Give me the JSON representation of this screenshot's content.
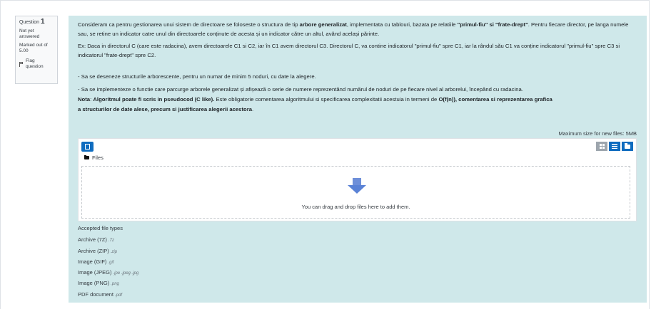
{
  "question_info": {
    "question_label": "Question",
    "question_number": "1",
    "state": "Not yet answered",
    "grade": "Marked out of 5.00",
    "flag_label": "Flag question"
  },
  "question": {
    "p1_a": "Consideram ca pentru gestionarea unui sistem de directoare se foloseste o structura de tip ",
    "p1_b": "arbore generalizat",
    "p1_c": ", implementata cu tablouri, bazata pe relatiile ",
    "p1_d": "\"primul-fiu\" si \"frate-drept\"",
    "p1_e": ". Pentru fiecare director, pe langa numele sau, se retine un indicator catre unul din directoarele conținute de acesta și un indicator către un altul, având același părinte.",
    "p2": "Ex: Daca in directorul C (care este radacina), avem directoarele C1 si C2, iar în C1 avem directorul C3. Directorul C, va contine indicatorul \"primul-fiu\" spre C1, iar la rândul său C1 va conține indicatorul \"primul-fiu\" spre C3 si indicatorul \"frate-drept\" spre C2.",
    "p3": "- Sa se deseneze structurile arborescente, pentru un numar de minim 5 noduri, cu date la alegere.",
    "p4": "- Sa se implementeze o functie care parcurge arborele generalizat și afișează o serie de numere reprezentând numărul de noduri de pe fiecare nivel al arborelui, începând cu radacina.",
    "p5_a": "Nota",
    "p5_b": ": ",
    "p5_c": "Algoritmul poate fi scris in pseudocod (C like).",
    "p5_d": " Este obligatorie comentarea algoritmului si specificarea complexitatii acestuia in termeni de ",
    "p5_e": "O(f(n)), comentarea si reprezentarea grafica",
    "p5_f": "a structurilor de date alese, precum si justificarea alegerii acestora",
    "p5_g": "."
  },
  "filemanager": {
    "max_size": "Maximum size for new files: 5MB",
    "path_label": "Files",
    "drop_text": "You can drag and drop files here to add them."
  },
  "accepted": {
    "heading": "Accepted file types",
    "types": [
      {
        "name": "Archive (7Z)",
        "ext": ".7z"
      },
      {
        "name": "Archive (ZIP)",
        "ext": ".zip"
      },
      {
        "name": "Image (GIF)",
        "ext": ".gif"
      },
      {
        "name": "Image (JPEG)",
        "ext": ".jpe .jpeg .jpg"
      },
      {
        "name": "Image (PNG)",
        "ext": ".png"
      },
      {
        "name": "PDF document",
        "ext": ".pdf"
      }
    ]
  },
  "colors": {
    "content_bg": "#cfe8ea",
    "primary": "#0f6cbf",
    "arrow": "#5a82d6"
  }
}
